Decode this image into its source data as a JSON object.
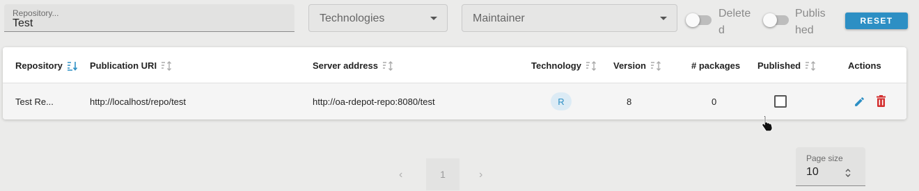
{
  "filters": {
    "repository": {
      "label": "Repository...",
      "value": "Test"
    },
    "technologies": {
      "placeholder": "Technologies"
    },
    "maintainer": {
      "placeholder": "Maintainer"
    },
    "deleted_toggle": {
      "label_line1": "Delete",
      "label_line2": "d",
      "on": false
    },
    "published_toggle": {
      "label_line1": "Publis",
      "label_line2": "hed",
      "on": false
    },
    "reset_label": "RESET"
  },
  "table": {
    "columns": [
      {
        "key": "repository",
        "label": "Repository",
        "sorted": "desc"
      },
      {
        "key": "publication_uri",
        "label": "Publication URI",
        "sorted": "none"
      },
      {
        "key": "server_address",
        "label": "Server address",
        "sorted": "none"
      },
      {
        "key": "technology",
        "label": "Technology",
        "sorted": "none"
      },
      {
        "key": "version",
        "label": "Version",
        "sorted": "none"
      },
      {
        "key": "packages",
        "label": "# packages"
      },
      {
        "key": "published",
        "label": "Published",
        "sorted": "none"
      },
      {
        "key": "actions",
        "label": "Actions"
      }
    ],
    "rows": [
      {
        "repository": "Test Re...",
        "publication_uri": "http://localhost/repo/test",
        "server_address": "http://oa-rdepot-repo:8080/test",
        "technology": "R",
        "version": "8",
        "packages": "0",
        "published": false
      }
    ]
  },
  "pagination": {
    "prev_icon": "chevron-left-icon",
    "current_page": "1",
    "next_icon": "chevron-right-icon",
    "page_size_label": "Page size",
    "page_size_value": "10"
  },
  "colors": {
    "accent": "#2d8fc4",
    "delete": "#d32f2f",
    "background": "#ebebea"
  }
}
